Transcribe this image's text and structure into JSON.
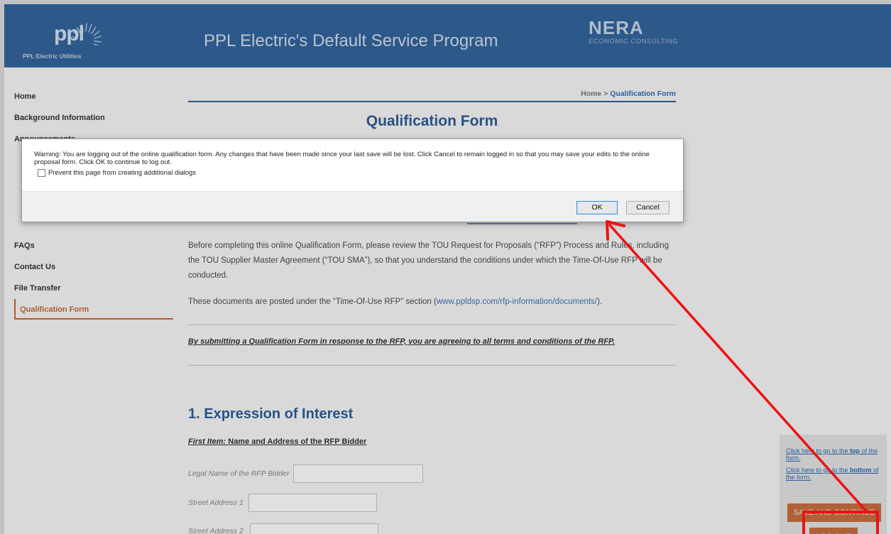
{
  "header": {
    "logo_text": "ppl",
    "logo_subtitle": "PPL Electric Utilities",
    "program_title": "PPL Electric's Default Service Program",
    "partner_name": "NERA",
    "partner_subtitle": "ECONOMIC CONSULTING"
  },
  "sidebar": {
    "items": [
      {
        "label": "Home"
      },
      {
        "label": "Background Information"
      },
      {
        "label": "Announcements"
      },
      {
        "label": "FAQs"
      },
      {
        "label": "Contact Us"
      },
      {
        "label": "File Transfer"
      },
      {
        "label": "Qualification Form"
      }
    ]
  },
  "breadcrumb": {
    "home": "Home",
    "separator": ">",
    "current": "Qualification Form"
  },
  "page_title": "Qualification Form",
  "intro": {
    "paragraph1": "Before completing this online Qualification Form, please review the TOU Request for Proposals (“RFP”) Process and Rules, including the TOU Supplier Master Agreement (“TOU SMA”), so that you understand the conditions under which the Time-Of-Use RFP will be conducted.",
    "paragraph2_prefix": "These documents are posted under the “Time-Of-Use RFP” section (",
    "paragraph2_link": "www.ppldsp.com/rfp-information/documents/",
    "paragraph2_suffix": ").",
    "agreement": "By submitting a Qualification Form in response to the RFP, you are agreeing to all terms and conditions of the RFP."
  },
  "section": {
    "title": "1. Expression of Interest",
    "first_item_label": "First Item:",
    "first_item_text": " Name and Address of the RFP Bidder",
    "fields": [
      {
        "label": "Legal Name of the RFP Bidder",
        "value": ""
      },
      {
        "label": "Street Address 1",
        "value": ""
      },
      {
        "label": "Street Address 2",
        "value": ""
      }
    ]
  },
  "float_panel": {
    "top_link_prefix": "Click here to go to the ",
    "top_link_bold": "top",
    "top_link_suffix": " of the form.",
    "bottom_link_prefix": "Click here to go to the ",
    "bottom_link_bold": "bottom",
    "bottom_link_suffix": " of the form.",
    "save_button": "SAVE AND CONTINUE",
    "logout_button": "LOG OUT"
  },
  "dialog": {
    "message": "Warning: You are logging out of the online qualification form. Any changes that have been made since your last save will be lost. Click Cancel to remain logged in so that you may save your edits to the online proposal form. Click OK to continue to log out.",
    "checkbox_label": "Prevent this page from creating additional dialogs",
    "checkbox_checked": false,
    "ok_label": "OK",
    "cancel_label": "Cancel"
  },
  "colors": {
    "header_blue": "#33659e",
    "accent_orange": "#c8703f",
    "title_blue": "#2d5e99",
    "annotation_red": "#ee1111"
  }
}
